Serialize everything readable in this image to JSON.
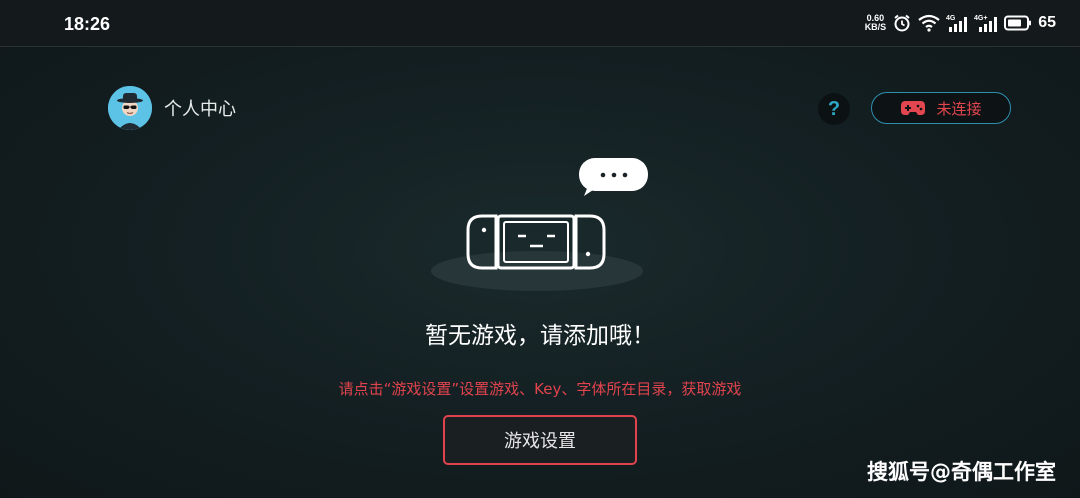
{
  "status_bar": {
    "time": "18:26",
    "net_speed_value": "0.60",
    "net_speed_unit": "KB/S",
    "battery": "65",
    "icons": [
      "alarm-icon",
      "wifi-icon",
      "signal-4g-icon",
      "signal-4g-plus-icon",
      "battery-icon"
    ]
  },
  "header": {
    "profile_label": "个人中心",
    "help_symbol": "?",
    "connection_status": "未连接"
  },
  "empty_state": {
    "bubble_text": "•••",
    "title": "暂无游戏，请添加哦！",
    "hint": "请点击“游戏设置”设置游戏、Key、字体所在目录，获取游戏",
    "button_label": "游戏设置"
  },
  "watermark": "搜狐号@奇偶工作室",
  "colors": {
    "accent_red": "#e0434d",
    "accent_blue": "#2ea8c7",
    "background": "#142023"
  }
}
